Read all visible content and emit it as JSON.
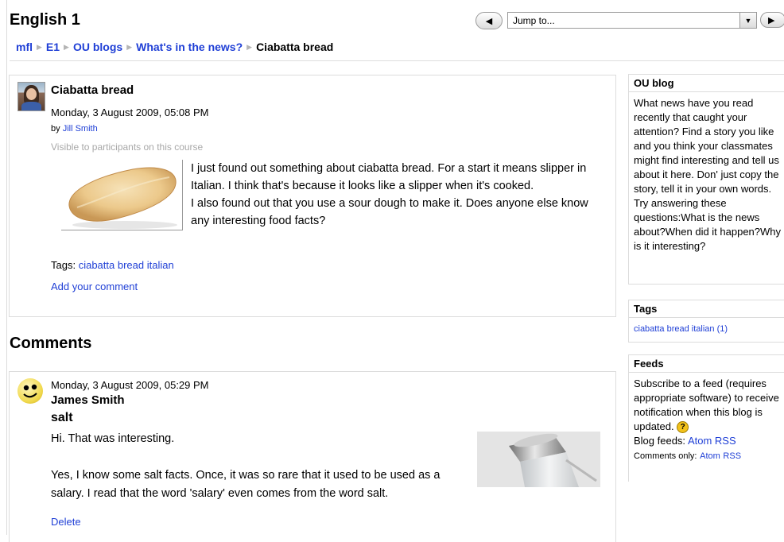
{
  "header": {
    "course_title": "English 1",
    "jump_placeholder": "Jump to...",
    "prev_icon": "triangle-left-icon",
    "next_icon": "triangle-right-icon"
  },
  "breadcrumb": {
    "items": [
      "mfl",
      "E1",
      "OU blogs",
      "What's in the news?",
      "Ciabatta bread"
    ]
  },
  "post": {
    "title": "Ciabatta bread",
    "date": "Monday, 3 August 2009, 05:08 PM",
    "by_prefix": "by",
    "author": "Jill Smith",
    "visibility": "Visible to participants on this course",
    "body_lines": [
      "I just found out something about ciabatta bread. For a start it means slipper in Italian. I think that's because it looks like a slipper when it's cooked.",
      "I also found out that you use a sour dough to make it. Does anyone else know any interesting food facts?"
    ],
    "tags_label": "Tags:",
    "tags": "ciabatta bread italian",
    "add_comment": "Add your comment"
  },
  "comments": {
    "heading": "Comments",
    "items": [
      {
        "date": "Monday, 3 August 2009, 05:29 PM",
        "author": "James Smith",
        "title": "salt",
        "paragraphs": [
          "Hi. That was interesting.",
          "Yes, I know some salt facts. Once, it was so rare that it used to be used as a salary. I read that the word 'salary' even comes from the word salt."
        ],
        "delete": "Delete"
      }
    ]
  },
  "sidebar": {
    "oublog": {
      "title": "OU blog",
      "text": "What news have you read recently that caught your attention? Find a story you like and you think your classmates might find interesting and tell us about it here. Don' just copy the story, tell it in your own words. Try answering these questions:What is the news about?When did it happen?Why is it interesting?"
    },
    "tags": {
      "title": "Tags",
      "link": "ciabatta bread italian (1)"
    },
    "feeds": {
      "title": "Feeds",
      "text": "Subscribe to a feed (requires appropriate software) to receive notification when this blog is updated.",
      "help_glyph": "?",
      "blog_feeds_label": "Blog feeds:",
      "comments_only_label": "Comments only:",
      "atom": "Atom",
      "rss": "RSS"
    }
  },
  "colors": {
    "link": "#1f3fd6",
    "border": "#dcdcdc",
    "muted": "#a8a8a8"
  }
}
